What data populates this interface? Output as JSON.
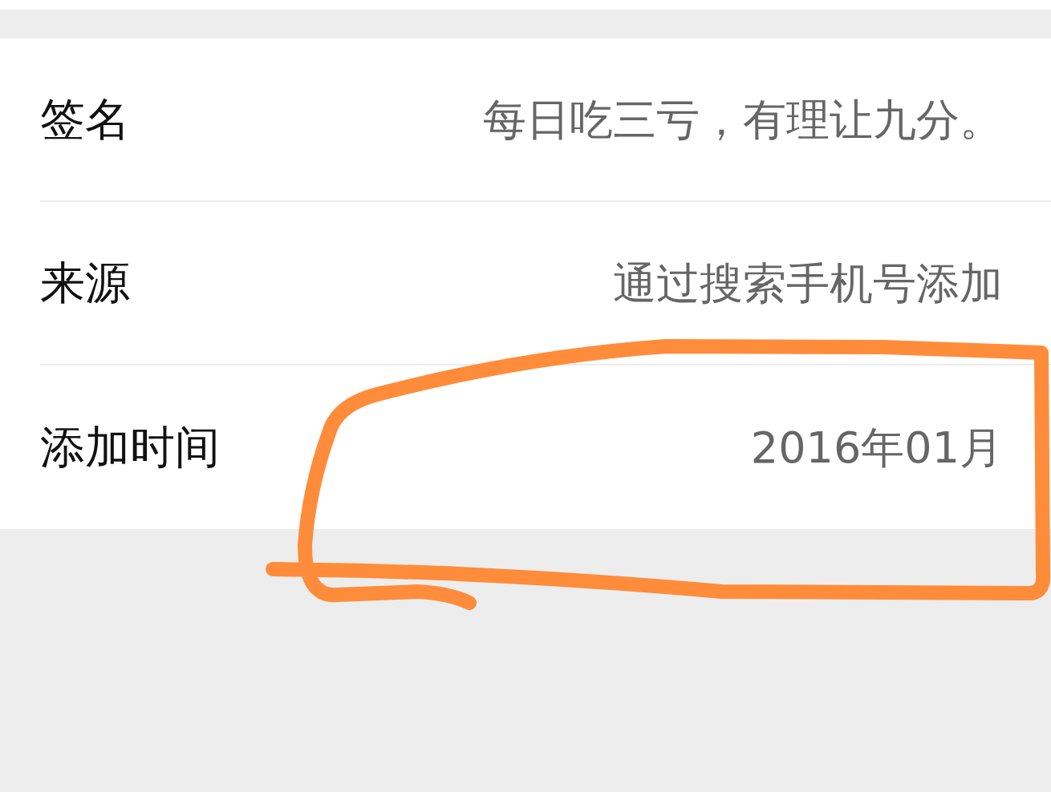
{
  "rows": [
    {
      "label": "签名",
      "value": "每日吃三亏，有理让九分。"
    },
    {
      "label": "来源",
      "value": "通过搜索手机号添加"
    },
    {
      "label": "添加时间",
      "value": "2016年01月"
    }
  ]
}
